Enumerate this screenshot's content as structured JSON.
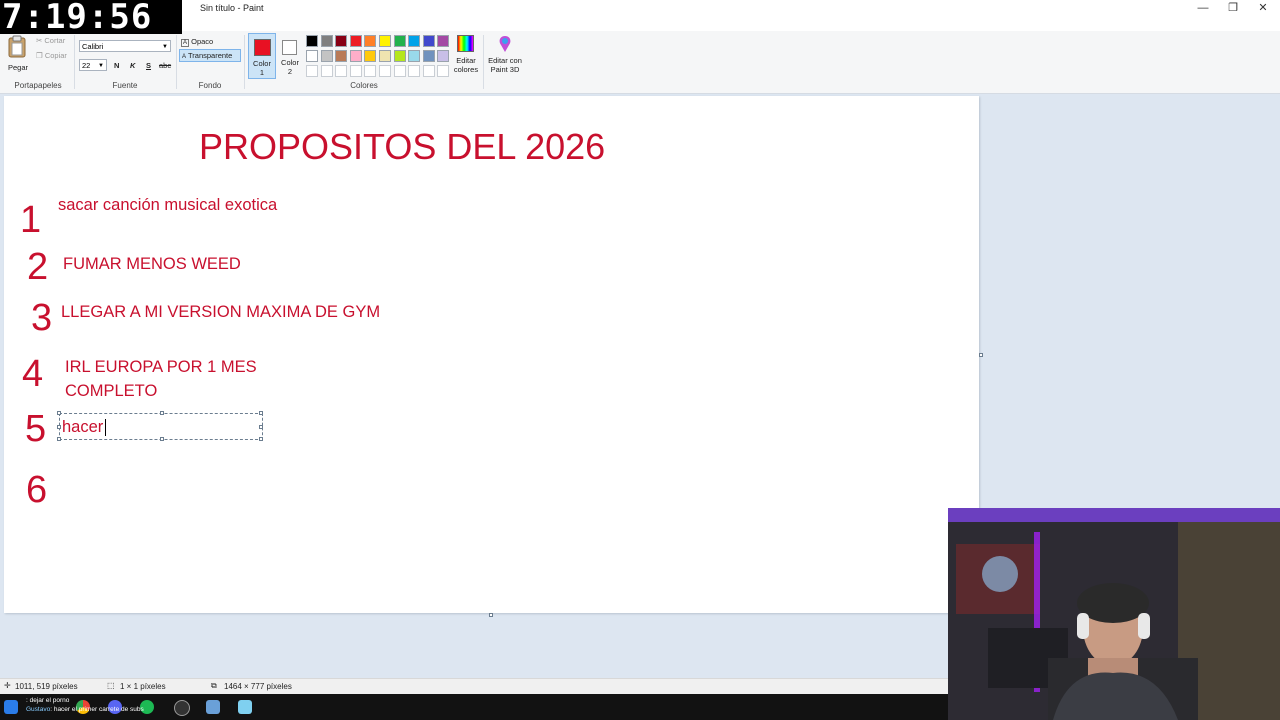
{
  "overlay": {
    "clock": "7:19:56"
  },
  "window": {
    "title": "Sin título - Paint",
    "min": "—",
    "restore": "❐",
    "close": "✕"
  },
  "ribbon": {
    "clipboard": {
      "paste": "Pegar",
      "cut": "Cortar",
      "copy": "Copiar",
      "label": "Portapapeles"
    },
    "font": {
      "family": "Calibri",
      "size": "22",
      "bold": "N",
      "italic": "K",
      "underline": "S",
      "strike": "abc",
      "label": "Fuente"
    },
    "background": {
      "opaque": "Opaco",
      "transparent": "Transparente",
      "label": "Fondo"
    },
    "color1": {
      "line1": "Color",
      "line2": "1",
      "value": "#e81123"
    },
    "color2": {
      "line1": "Color",
      "line2": "2",
      "value": "#ffffff"
    },
    "colors_label": "Colores",
    "edit_colors": {
      "line1": "Editar",
      "line2": "colores"
    },
    "paint3d": {
      "line1": "Editar con",
      "line2": "Paint 3D"
    },
    "palette_row1": [
      "#000000",
      "#7f7f7f",
      "#880015",
      "#ed1c24",
      "#ff7f27",
      "#fff200",
      "#22b14c",
      "#00a2e8",
      "#3f48cc",
      "#a349a4"
    ],
    "palette_row2": [
      "#ffffff",
      "#c3c3c3",
      "#b97a57",
      "#ffaec9",
      "#ffc90e",
      "#efe4b0",
      "#b5e61d",
      "#99d9ea",
      "#7092be",
      "#c8bfe7"
    ]
  },
  "canvas": {
    "text_color": "#c8102e",
    "title": "PROPOSITOS DEL 2026",
    "items": [
      {
        "num": "1",
        "text": "sacar canción musical exotica"
      },
      {
        "num": "2",
        "text": "FUMAR MENOS WEED"
      },
      {
        "num": "3",
        "text": "LLEGAR A MI VERSION MAXIMA DE GYM"
      },
      {
        "num": "4",
        "line1": "IRL EUROPA POR 1 MES",
        "line2": "COMPLETO"
      },
      {
        "num": "5",
        "text": "hacer"
      },
      {
        "num": "6"
      }
    ]
  },
  "status": {
    "cursor": "1011, 519 píxeles",
    "selection": "1 × 1 píxeles",
    "size": "1464 × 777 píxeles"
  },
  "taskbar": {
    "chat_line1": ": dejar el porno",
    "chat_user": "Gustavo",
    "chat_line2": ": hacer el primer carrete de subs"
  }
}
